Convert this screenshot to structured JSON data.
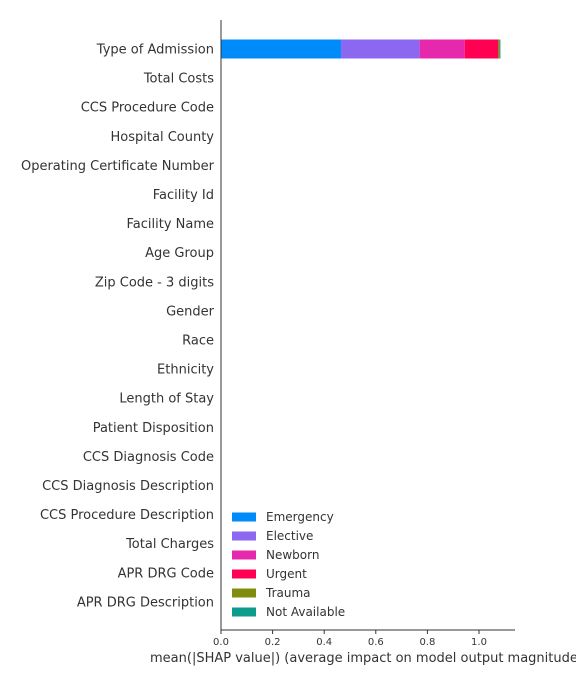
{
  "chart_data": {
    "type": "bar",
    "orientation": "horizontal",
    "stacked": true,
    "categories": [
      "Type of Admission",
      "Total Costs",
      "CCS Procedure Code",
      "Hospital County",
      "Operating Certificate Number",
      "Facility Id",
      "Facility Name",
      "Age Group",
      "Zip Code - 3 digits",
      "Gender",
      "Race",
      "Ethnicity",
      "Length of Stay",
      "Patient Disposition",
      "CCS Diagnosis Code",
      "CCS Diagnosis Description",
      "CCS Procedure Description",
      "Total Charges",
      "APR DRG Code",
      "APR DRG Description"
    ],
    "series": [
      {
        "name": "Emergency",
        "color": "#008bfb",
        "values": [
          0.465,
          0,
          0,
          0,
          0,
          0,
          0,
          0,
          0,
          0,
          0,
          0,
          0,
          0,
          0,
          0,
          0,
          0,
          0,
          0
        ]
      },
      {
        "name": "Elective",
        "color": "#8c67f0",
        "values": [
          0.305,
          0,
          0,
          0,
          0,
          0,
          0,
          0,
          0,
          0,
          0,
          0,
          0,
          0,
          0,
          0,
          0,
          0,
          0,
          0
        ]
      },
      {
        "name": "Newborn",
        "color": "#e628ac",
        "values": [
          0.175,
          0,
          0,
          0,
          0,
          0,
          0,
          0,
          0,
          0,
          0,
          0,
          0,
          0,
          0,
          0,
          0,
          0,
          0,
          0
        ]
      },
      {
        "name": "Urgent",
        "color": "#ff0052",
        "values": [
          0.13,
          0,
          0,
          0,
          0,
          0,
          0,
          0,
          0,
          0,
          0,
          0,
          0,
          0,
          0,
          0,
          0,
          0,
          0,
          0
        ]
      },
      {
        "name": "Trauma",
        "color": "#7f8c0d",
        "values": [
          0.005,
          0,
          0,
          0,
          0,
          0,
          0,
          0,
          0,
          0,
          0,
          0,
          0,
          0,
          0,
          0,
          0,
          0,
          0,
          0
        ]
      },
      {
        "name": "Not Available",
        "color": "#0d9c8c",
        "values": [
          0.003,
          0,
          0,
          0,
          0,
          0,
          0,
          0,
          0,
          0,
          0,
          0,
          0,
          0,
          0,
          0,
          0,
          0,
          0,
          0
        ]
      }
    ],
    "xlabel": "mean(|SHAP value|) (average impact on model output magnitude)",
    "xlim": [
      0,
      1.14
    ],
    "xticks": [
      0.0,
      0.2,
      0.4,
      0.6,
      0.8,
      1.0
    ],
    "xtick_labels": [
      "0.0",
      "0.2",
      "0.4",
      "0.6",
      "0.8",
      "1.0"
    ],
    "legend_position": "bottom-left",
    "grid": false
  }
}
